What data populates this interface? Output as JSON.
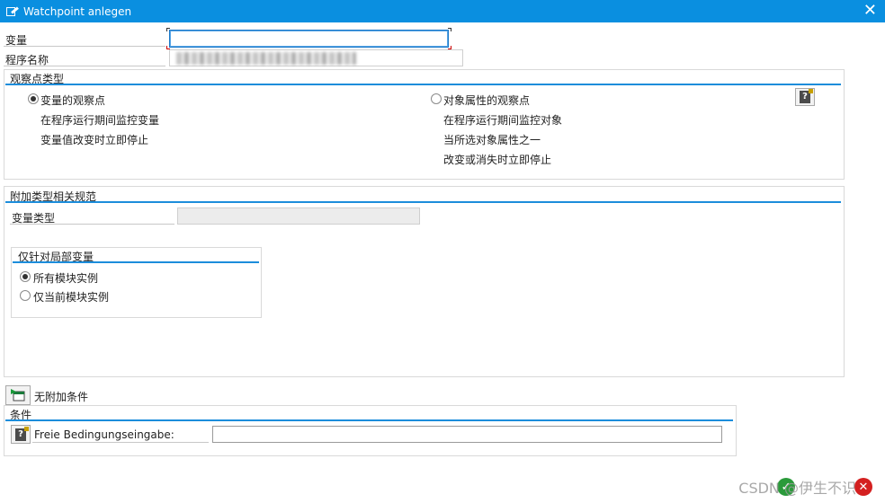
{
  "window": {
    "title": "Watchpoint anlegen",
    "close_symbol": "✕"
  },
  "fields": {
    "variable_label": "变量",
    "variable_value": "",
    "program_label": "程序名称"
  },
  "watch_type": {
    "title": "观察点类型",
    "option1": {
      "label": "变量的观察点",
      "desc1": "在程序运行期间监控变量",
      "desc2": "变量值改变时立即停止",
      "selected": true
    },
    "option2": {
      "label": "对象属性的观察点",
      "desc1": "在程序运行期间监控对象",
      "desc2": "当所选对象属性之一",
      "desc3": "改变或消失时立即停止",
      "selected": false
    }
  },
  "extra": {
    "title": "附加类型相关规范",
    "vartype_label": "变量类型",
    "local": {
      "title": "仅针对局部变量",
      "opt_all": "所有模块实例",
      "opt_current": "仅当前模块实例"
    }
  },
  "condition": {
    "toggle_label": "无附加条件",
    "title": "条件",
    "free_label": "Freie Bedingungseingabe:",
    "free_value": ""
  },
  "watermark": "CSDN @伊生不识",
  "icons": {
    "title": "edit-document-icon",
    "help": "help-book-icon",
    "confirm": "check-icon",
    "cancel": "cancel-icon"
  },
  "colors": {
    "titlebar": "#0a8fe0",
    "accent": "#1c8ddb"
  }
}
